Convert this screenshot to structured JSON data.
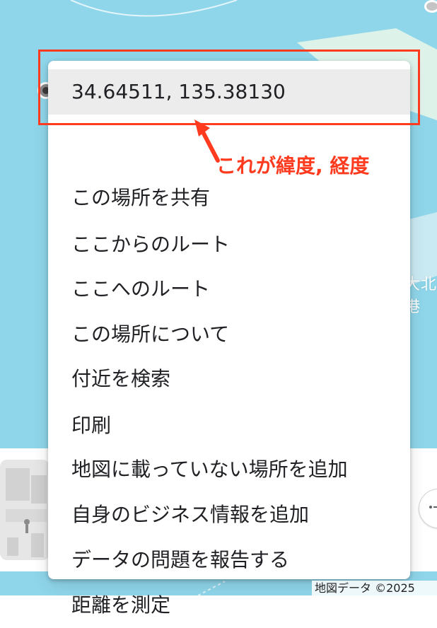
{
  "context_menu": {
    "coordinates": "34.64511, 135.38130",
    "items": [
      "この場所を共有",
      "ここからのルート",
      "ここへのルート",
      "この場所について",
      "付近を検索",
      "印刷",
      "地図に載っていない場所を追加",
      "自身のビジネス情報を追加",
      "データの問題を報告する",
      "距離を測定"
    ]
  },
  "annotation": {
    "text": "これが緯度, 経度",
    "color": "#ff3b1f"
  },
  "map": {
    "label_right": "大北港",
    "attribution": "地図データ ©2025",
    "water_color": "#8fd6ea"
  }
}
